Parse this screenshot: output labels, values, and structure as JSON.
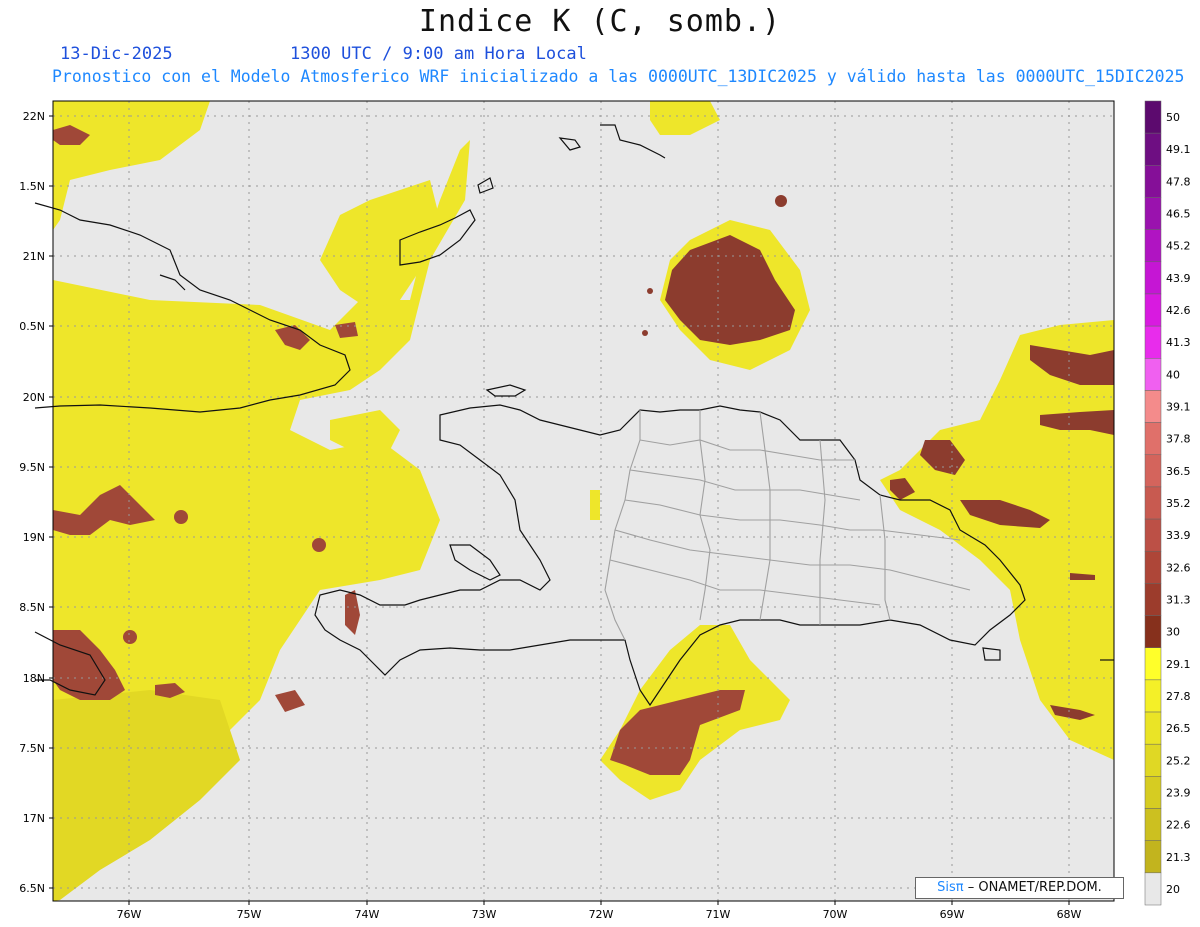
{
  "title": "Indice K (C, somb.)",
  "date": "13-Dic-2025",
  "time": "1300 UTC / 9:00 am Hora Local",
  "forecast": "Pronostico con el Modelo Atmosferico WRF inicializado a las 0000UTC_13DIC2025 y válido hasta las  0000UTC_15DIC2025",
  "credit": {
    "sis": "Sisπ",
    "org": "– ONAMET/REP.DOM."
  },
  "axes": {
    "lon_labels": [
      "76W",
      "75W",
      "74W",
      "73W",
      "72W",
      "71W",
      "70W",
      "69W",
      "68W"
    ],
    "lat_labels": [
      "22N",
      "1.5N",
      "21N",
      "0.5N",
      "20N",
      "9.5N",
      "19N",
      "8.5N",
      "18N",
      "7.5N",
      "17N",
      "6.5N"
    ]
  },
  "legend": {
    "values": [
      "50",
      "49.1",
      "47.8",
      "46.5",
      "45.2",
      "43.9",
      "42.6",
      "41.3",
      "40",
      "39.1",
      "37.8",
      "36.5",
      "35.2",
      "33.9",
      "32.6",
      "31.3",
      "30",
      "29.1",
      "27.8",
      "26.5",
      "25.2",
      "23.9",
      "22.6",
      "21.3",
      "20"
    ],
    "colors": [
      "#5c0a6e",
      "#6e0e82",
      "#850f98",
      "#9a12ae",
      "#b014c2",
      "#c516d4",
      "#d81ae0",
      "#e82cec",
      "#f060f0",
      "#f48b8b",
      "#e0706a",
      "#d4645c",
      "#c85a50",
      "#bc5046",
      "#ae4638",
      "#9c3c2c",
      "#86301c",
      "#ffff2a",
      "#f4f028",
      "#eae426",
      "#e0d824",
      "#d6cc22",
      "#ccc020",
      "#c2b41e",
      "#e8e8e8"
    ]
  },
  "colors": {
    "land_bg": "#e8e8e8",
    "yellow": "#f0ee2a",
    "brown": "#8a3a2a",
    "coast": "#111111",
    "provinces": "#a0a0a0"
  }
}
